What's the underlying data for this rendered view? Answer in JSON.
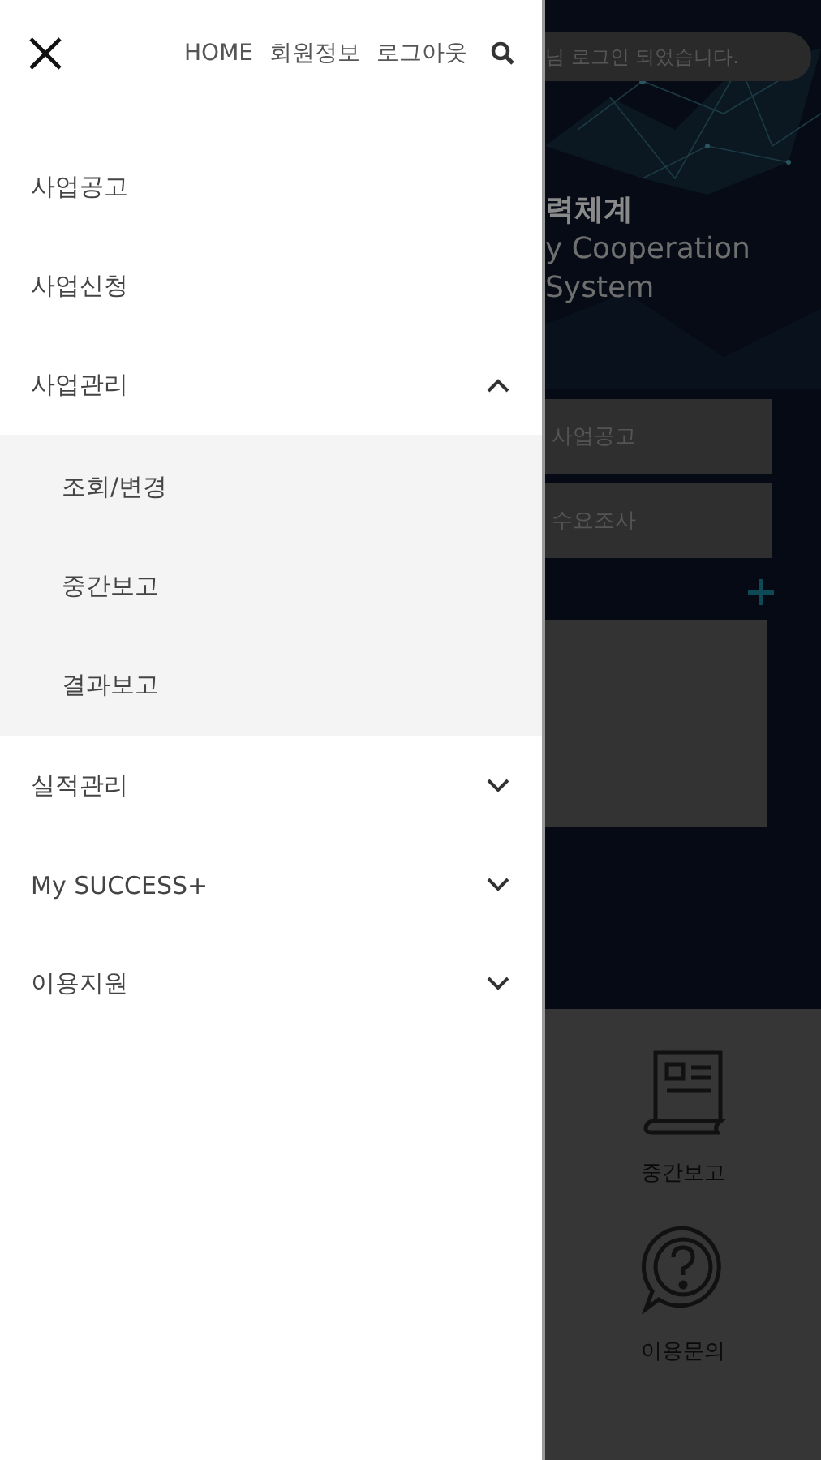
{
  "drawer": {
    "links": [
      "HOME",
      "회원정보",
      "로그아웃"
    ],
    "menu": [
      {
        "label": "사업공고",
        "kind": "link"
      },
      {
        "label": "사업신청",
        "kind": "link"
      },
      {
        "label": "사업관리",
        "kind": "group",
        "expanded": true,
        "children": [
          {
            "label": "조회/변경"
          },
          {
            "label": "중간보고"
          },
          {
            "label": "결과보고"
          }
        ]
      },
      {
        "label": "실적관리",
        "kind": "group",
        "expanded": false
      },
      {
        "label": "My SUCCESS+",
        "kind": "group",
        "expanded": false
      },
      {
        "label": "이용지원",
        "kind": "group",
        "expanded": false
      }
    ]
  },
  "background": {
    "notice": "님 로그인 되었습니다.",
    "title_lines": [
      "력체계",
      "y Cooperation",
      "System"
    ],
    "buttons": [
      "사업공고",
      "수요조사"
    ],
    "quick_links": [
      {
        "label": "중간보고",
        "kind": "report"
      },
      {
        "label": "이용문의",
        "kind": "help"
      }
    ]
  }
}
